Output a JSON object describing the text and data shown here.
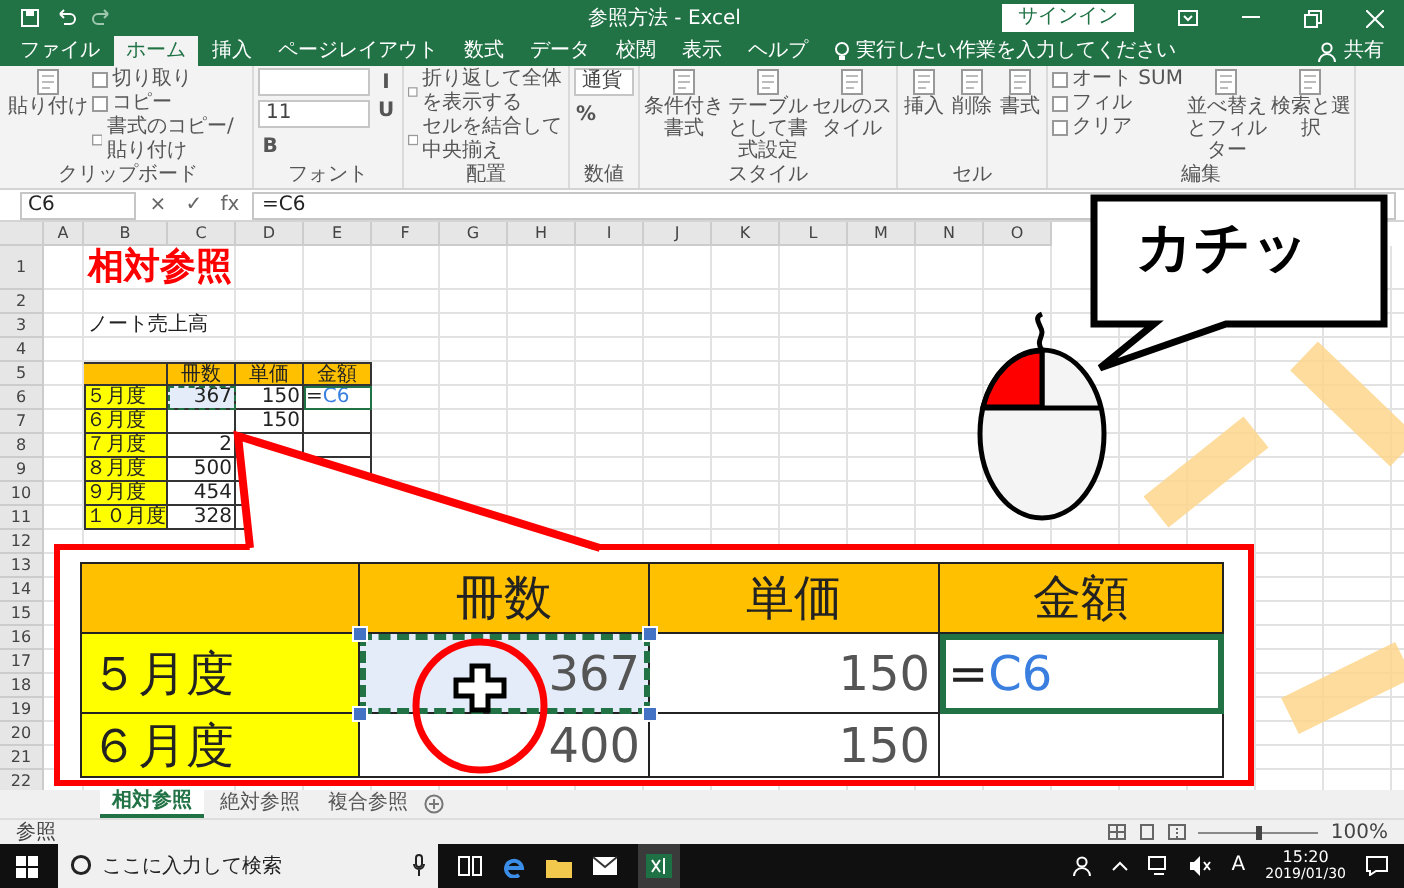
{
  "window": {
    "title": "参照方法 - Excel",
    "sign_in": "サインイン"
  },
  "tabs": [
    {
      "label": "ファイル",
      "selected": false
    },
    {
      "label": "ホーム",
      "selected": true
    },
    {
      "label": "挿入",
      "selected": false
    },
    {
      "label": "ページレイアウト",
      "selected": false
    },
    {
      "label": "数式",
      "selected": false
    },
    {
      "label": "データ",
      "selected": false
    },
    {
      "label": "校閲",
      "selected": false
    },
    {
      "label": "表示",
      "selected": false
    },
    {
      "label": "ヘルプ",
      "selected": false
    }
  ],
  "tell_me": {
    "placeholder": "実行したい作業を入力してください"
  },
  "share": "共有",
  "ribbon": {
    "groups": [
      {
        "label": "クリップボード",
        "items": [
          {
            "kind": "large",
            "text": "貼り付け"
          },
          {
            "kind": "small",
            "text": "切り取り"
          },
          {
            "kind": "small",
            "text": "コピー"
          },
          {
            "kind": "small",
            "text": "書式のコピー/貼り付け"
          }
        ]
      },
      {
        "label": "フォント",
        "items": [
          {
            "kind": "blank_field"
          },
          {
            "kind": "field",
            "text": "11"
          },
          {
            "kind": "glyph",
            "text": "B"
          },
          {
            "kind": "glyph",
            "text": "I"
          },
          {
            "kind": "glyph",
            "text": "U"
          }
        ]
      },
      {
        "label": "配置",
        "items": [
          {
            "kind": "small",
            "text": "折り返して全体を表示する"
          },
          {
            "kind": "small",
            "text": "セルを結合して中央揃え"
          }
        ]
      },
      {
        "label": "数値",
        "items": [
          {
            "kind": "field",
            "text": "通貨"
          },
          {
            "kind": "glyph",
            "text": "%"
          }
        ]
      },
      {
        "label": "スタイル",
        "items": [
          {
            "kind": "large",
            "text": "条件付き書式"
          },
          {
            "kind": "large",
            "text": "テーブルとして書式設定"
          },
          {
            "kind": "large",
            "text": "セルのスタイル"
          }
        ]
      },
      {
        "label": "セル",
        "items": [
          {
            "kind": "large",
            "text": "挿入"
          },
          {
            "kind": "large",
            "text": "削除"
          },
          {
            "kind": "large",
            "text": "書式"
          }
        ]
      },
      {
        "label": "編集",
        "items": [
          {
            "kind": "small",
            "text": "オート SUM"
          },
          {
            "kind": "small",
            "text": "フィル"
          },
          {
            "kind": "small",
            "text": "クリア"
          },
          {
            "kind": "large",
            "text": "並べ替えとフィルター"
          },
          {
            "kind": "large",
            "text": "検索と選択"
          }
        ]
      }
    ]
  },
  "name_box": "C6",
  "formula_buttons": [
    "×",
    "✓",
    "fx"
  ],
  "formula": "=C6",
  "sheet": {
    "columns": [
      "A",
      "B",
      "C",
      "D",
      "E",
      "F",
      "G",
      "H",
      "I",
      "J",
      "K",
      "L",
      "M",
      "N",
      "O"
    ],
    "rows": [
      "1",
      "2",
      "3",
      "4",
      "5",
      "6",
      "7",
      "8",
      "9",
      "10",
      "11",
      "12",
      "13",
      "14",
      "15",
      "16",
      "17",
      "18",
      "19",
      "20",
      "21",
      "22"
    ],
    "title": "相対参照",
    "subtitle": "ノート売上高",
    "table": {
      "header": [
        "冊数",
        "単価",
        "金額"
      ],
      "rows": [
        {
          "label": "５月度",
          "count": "367",
          "price": "150",
          "formula": {
            "op": "=",
            "ref": "C6"
          },
          "selected": true
        },
        {
          "label": "６月度",
          "price": "150",
          "selected": false
        },
        {
          "label": "７月度",
          "count": "2",
          "selected": false
        },
        {
          "label": "８月度",
          "count": "500",
          "selected": false
        },
        {
          "label": "９月度",
          "count": "454",
          "selected": false
        },
        {
          "label": "１０月度",
          "count": "328",
          "selected": false
        }
      ]
    }
  },
  "zoom_inset": {
    "header": [
      "冊数",
      "単価",
      "金額"
    ],
    "rows": [
      {
        "label": "５月度",
        "count": "367",
        "price": "150",
        "formula": {
          "op": "=",
          "ref": "C6"
        },
        "selected": true
      },
      {
        "label": "６月度",
        "count": "400",
        "price": "150",
        "selected": false
      }
    ]
  },
  "mouse": {
    "left_pressed": true
  },
  "bubble": "カチッ",
  "sheet_tabs": [
    {
      "label": "相対参照",
      "selected": true
    },
    {
      "label": "絶対参照",
      "selected": false
    },
    {
      "label": "複合参照",
      "selected": false
    }
  ],
  "status": "参照",
  "zoom": "100%",
  "zoom_slider": {
    "level": 0.5
  },
  "taskbar": {
    "search": {
      "placeholder": "ここに入力して検索"
    },
    "ime": "A",
    "time": "15:20",
    "date": "2019/01/30"
  }
}
